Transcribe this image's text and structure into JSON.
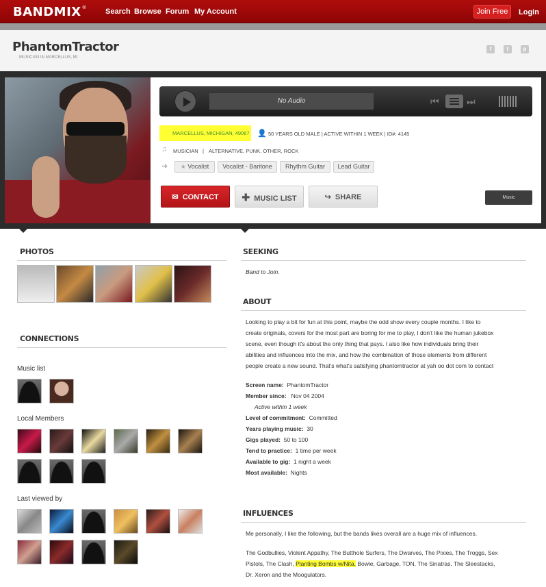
{
  "nav": {
    "logo": "BANDMIX",
    "logo_mark": "®",
    "links": [
      "Search",
      "Browse",
      "Forum",
      "My Account"
    ],
    "join": "Join Free",
    "login": "Login"
  },
  "header": {
    "name": "PhantomTractor",
    "subtitle": "MUSICIAN IN MARCELLUS, MI",
    "social_icons": [
      "facebook-icon",
      "twitter-icon",
      "pinterest-icon"
    ]
  },
  "player": {
    "status": "No Audio"
  },
  "profile": {
    "location": "MARCELLUS, MICHIGAN, 49067",
    "details": "50 YEARS OLD MALE  |  ACTIVE WITHIN 1 WEEK  |  ID#: 4145",
    "type": "MUSICIAN",
    "genres": "ALTERNATIVE, PUNK, OTHER, ROCK",
    "instruments": [
      "Vocalist",
      "Vocalist - Baritone",
      "Rhythm Guitar",
      "Lead Guitar"
    ],
    "contact_label": "CONTACT",
    "music_list_label": "MUSIC LIST",
    "share_label": "SHARE",
    "badge": "Music"
  },
  "photos": {
    "title": "PHOTOS",
    "count": 5
  },
  "connections": {
    "title": "CONNECTIONS",
    "music_list_label": "Music list",
    "local_members_label": "Local Members",
    "last_viewed_label": "Last viewed by"
  },
  "seeking": {
    "title": "SEEKING",
    "text": "Band to Join."
  },
  "about": {
    "title": "ABOUT",
    "lines": [
      "Looking to play a bit for fun at this point, maybe the odd show every couple months. I like to",
      "create originals, covers for the most part are boring for me to play, I don't like the human jukebox",
      "scene, even though it's about the only thing that pays. I also like how individuals bring their",
      "abilities and influences into the mix, and how the combination of those elements from different",
      "people create a new sound. That's what's satisfying phantomtractor at yah oo dot com to contact"
    ],
    "details": [
      {
        "label": "Screen name:",
        "value": "PhantomTractor"
      },
      {
        "label": "Member since:",
        "value": "Nov 04 2004"
      },
      {
        "label": "",
        "value": "Active within 1 week"
      },
      {
        "label": "Level of commitment:",
        "value": "Committed"
      },
      {
        "label": "Years playing music:",
        "value": "30"
      },
      {
        "label": "Gigs played:",
        "value": "50 to 100"
      },
      {
        "label": "Tend to practice:",
        "value": "1 time per week"
      },
      {
        "label": "Available to gig:",
        "value": "1 night a week"
      },
      {
        "label": "Most available:",
        "value": "Nights"
      }
    ]
  },
  "influences": {
    "title": "INFLUENCES",
    "intro": "Me personally, I like the following, but the bands likes overall are a huge mix of influences.",
    "line1": "The Godbullies, Violent Appathy, The Butthole Surfers, The Dwarves, The Pixies, The Troggs, Sex",
    "line2_a": "Pistols, The Clash, ",
    "line2_hl": "Planting Bombs w/Nita,",
    "line2_b": " Bowie, Garbage, TON, The Sinatras, The Sleestacks,",
    "line3": "Dr. Xeron and the Moogulators."
  },
  "colors": {
    "brand_red": "#a00909",
    "highlight": "#ffff33",
    "location_green": "#3a8d2b"
  }
}
